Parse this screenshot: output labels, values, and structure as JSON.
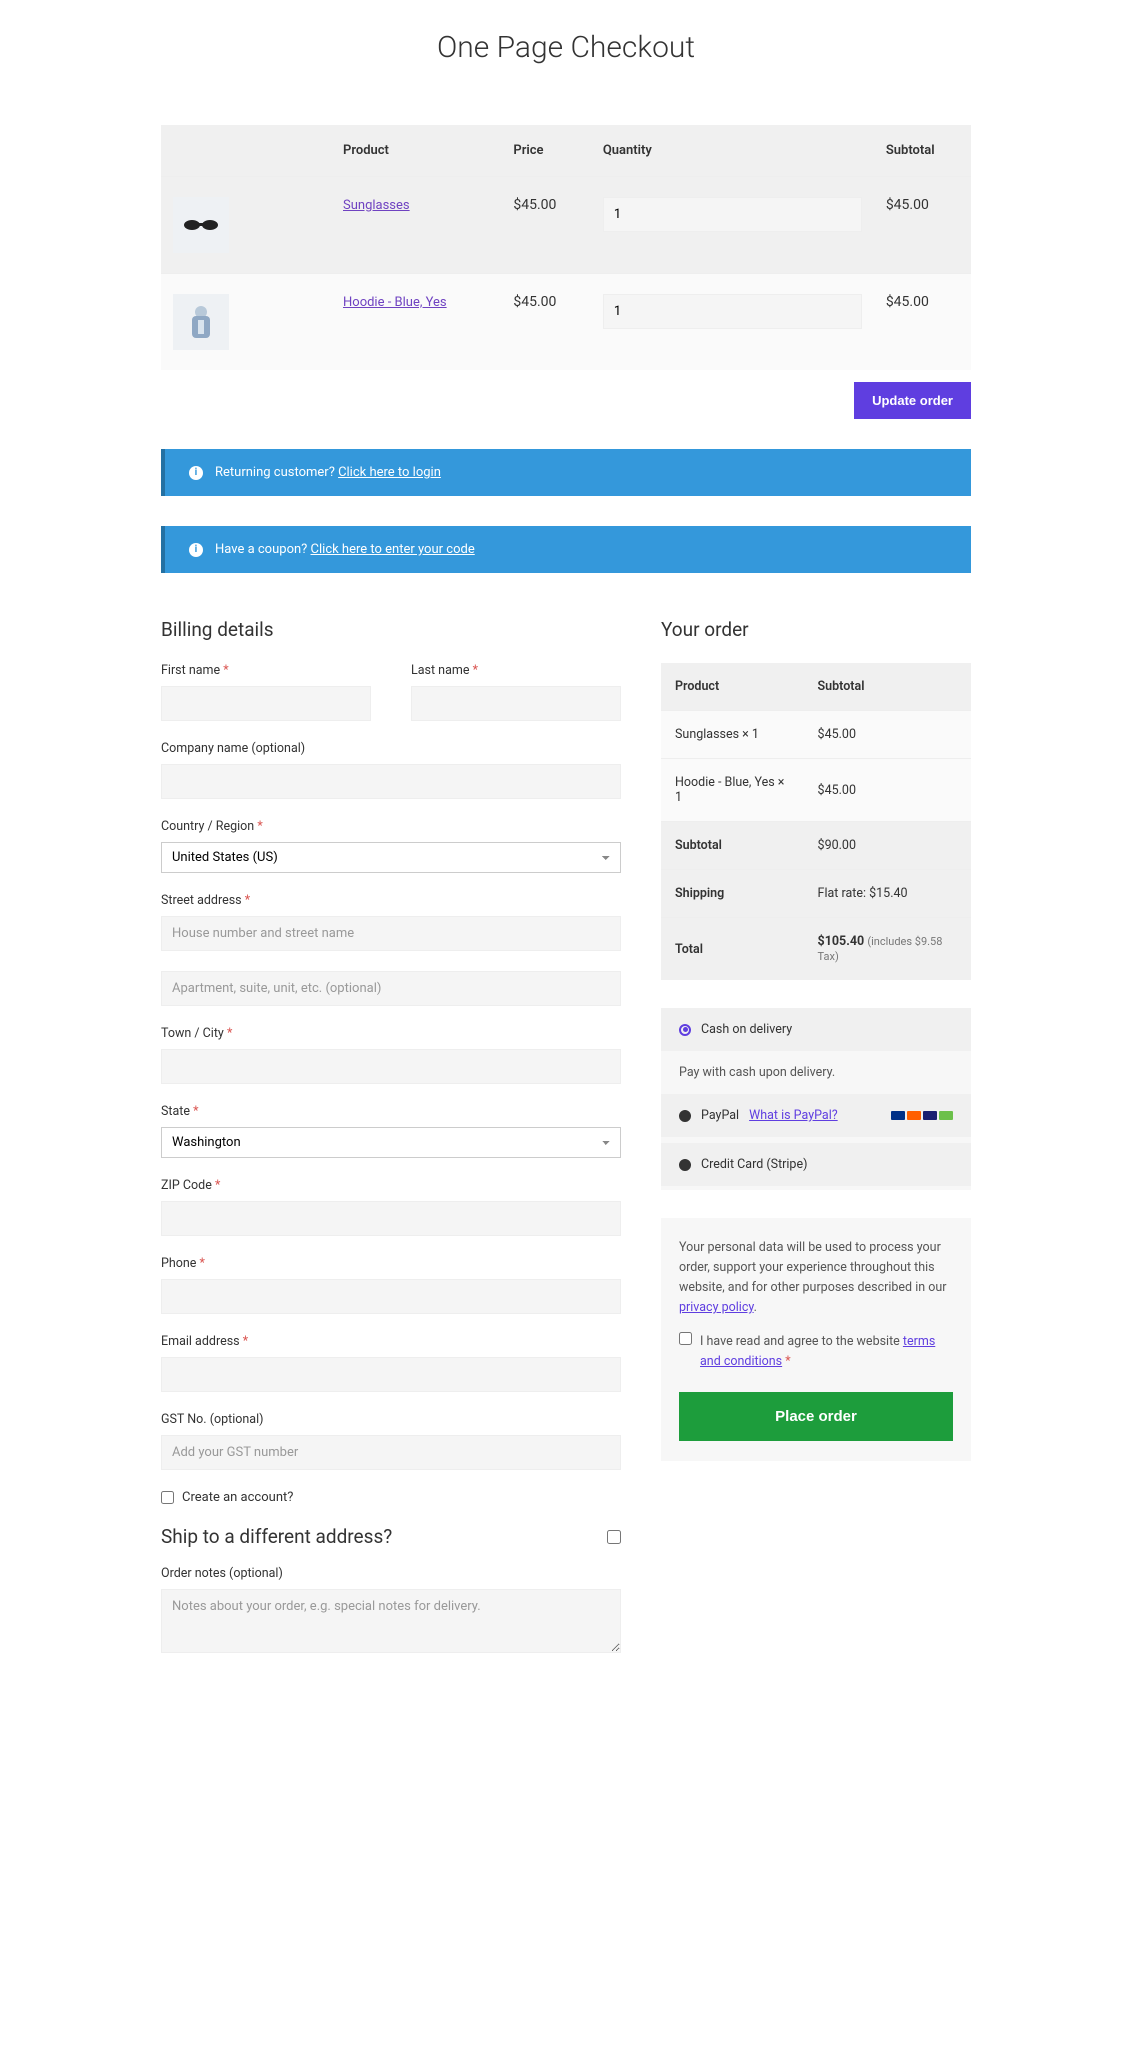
{
  "page_title": "One Page Checkout",
  "cart": {
    "headers": {
      "product": "Product",
      "price": "Price",
      "quantity": "Quantity",
      "subtotal": "Subtotal"
    },
    "items": [
      {
        "name": "Sunglasses",
        "price": "$45.00",
        "qty": "1",
        "subtotal": "$45.00"
      },
      {
        "name": "Hoodie - Blue, Yes",
        "price": "$45.00",
        "qty": "1",
        "subtotal": "$45.00"
      }
    ],
    "update_label": "Update order"
  },
  "notices": {
    "returning_prefix": "Returning customer? ",
    "returning_link": "Click here to login",
    "coupon_prefix": "Have a coupon? ",
    "coupon_link": "Click here to enter your code"
  },
  "billing": {
    "heading": "Billing details",
    "first_name": "First name",
    "last_name": "Last name",
    "company": "Company name (optional)",
    "country": "Country / Region",
    "country_value": "United States (US)",
    "street": "Street address",
    "street_ph": "House number and street name",
    "street2_ph": "Apartment, suite, unit, etc. (optional)",
    "city": "Town / City",
    "state": "State",
    "state_value": "Washington",
    "zip": "ZIP Code",
    "phone": "Phone",
    "email": "Email address",
    "gst": "GST No. (optional)",
    "gst_ph": "Add your GST number",
    "create_account": "Create an account?"
  },
  "shipping": {
    "heading": "Ship to a different address?",
    "notes_label": "Order notes (optional)",
    "notes_ph": "Notes about your order, e.g. special notes for delivery."
  },
  "order": {
    "heading": "Your order",
    "th_product": "Product",
    "th_subtotal": "Subtotal",
    "lines": [
      {
        "label": "Sunglasses  × 1",
        "value": "$45.00"
      },
      {
        "label": "Hoodie - Blue, Yes  × 1",
        "value": "$45.00"
      }
    ],
    "subtotal_label": "Subtotal",
    "subtotal_value": "$90.00",
    "shipping_label": "Shipping",
    "shipping_value": "Flat rate: $15.40",
    "total_label": "Total",
    "total_value": "$105.40",
    "tax_note": "(includes $9.58 Tax)"
  },
  "payment": {
    "cod": "Cash on delivery",
    "cod_desc": "Pay with cash upon delivery.",
    "paypal": "PayPal",
    "paypal_help": "What is PayPal?",
    "stripe": "Credit Card (Stripe)"
  },
  "terms": {
    "privacy_text": "Your personal data will be used to process your order, support your experience throughout this website, and for other purposes described in our ",
    "privacy_link": "privacy policy",
    "agree_prefix": "I have read and agree to the website ",
    "agree_link": "terms and conditions",
    "place_order": "Place order"
  }
}
